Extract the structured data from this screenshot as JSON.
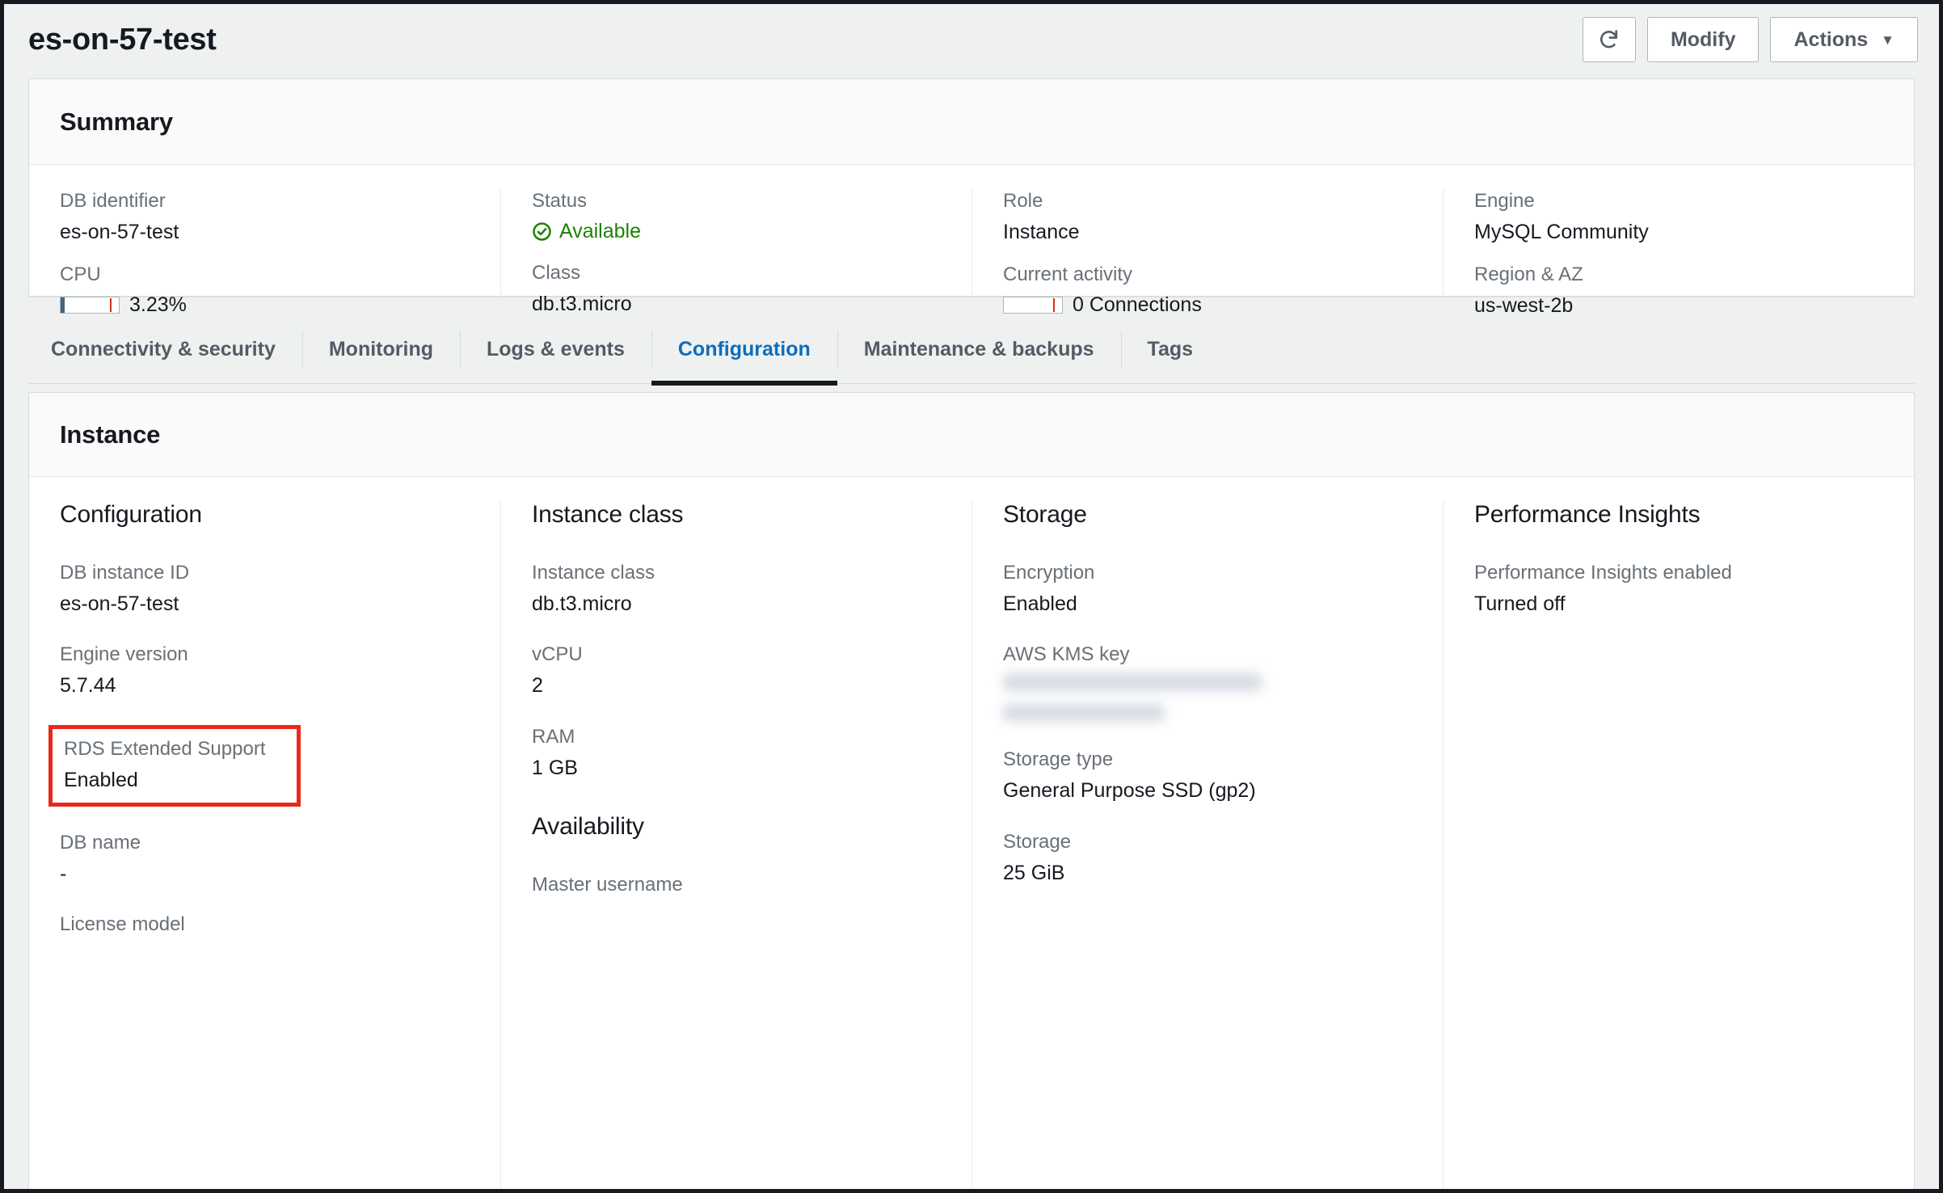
{
  "header": {
    "title": "es-on-57-test",
    "refresh_icon": "refresh-icon",
    "modify_label": "Modify",
    "actions_label": "Actions",
    "actions_caret": "▼"
  },
  "summary": {
    "section_title": "Summary",
    "columns": [
      {
        "fields": [
          {
            "label": "DB identifier",
            "value": "es-on-57-test",
            "kind": "text"
          },
          {
            "label": "CPU",
            "value": "3.23%",
            "kind": "meter",
            "fill_pct": 7,
            "threshold_pct": 85
          }
        ]
      },
      {
        "fields": [
          {
            "label": "Status",
            "value": "Available",
            "kind": "status",
            "status_color": "#1d8102",
            "icon": "check-circle-icon"
          },
          {
            "label": "Class",
            "value": "db.t3.micro",
            "kind": "text"
          }
        ]
      },
      {
        "fields": [
          {
            "label": "Role",
            "value": "Instance",
            "kind": "text"
          },
          {
            "label": "Current activity",
            "value": "0 Connections",
            "kind": "meter",
            "fill_pct": 0,
            "threshold_pct": 85
          }
        ]
      },
      {
        "fields": [
          {
            "label": "Engine",
            "value": "MySQL Community",
            "kind": "text"
          },
          {
            "label": "Region & AZ",
            "value": "us-west-2b",
            "kind": "text"
          }
        ]
      }
    ]
  },
  "tabs": [
    {
      "label": "Connectivity & security",
      "active": false
    },
    {
      "label": "Monitoring",
      "active": false
    },
    {
      "label": "Logs & events",
      "active": false
    },
    {
      "label": "Configuration",
      "active": true
    },
    {
      "label": "Maintenance & backups",
      "active": false
    },
    {
      "label": "Tags",
      "active": false
    }
  ],
  "instance": {
    "section_title": "Instance",
    "configuration": {
      "title": "Configuration",
      "db_instance_id_label": "DB instance ID",
      "db_instance_id_value": "es-on-57-test",
      "engine_version_label": "Engine version",
      "engine_version_value": "5.7.44",
      "extended_support_label": "RDS Extended Support",
      "extended_support_value": "Enabled",
      "db_name_label": "DB name",
      "db_name_value": "-",
      "license_model_label": "License model"
    },
    "instance_class": {
      "title": "Instance class",
      "instance_class_label": "Instance class",
      "instance_class_value": "db.t3.micro",
      "vcpu_label": "vCPU",
      "vcpu_value": "2",
      "ram_label": "RAM",
      "ram_value": "1 GB",
      "availability_title": "Availability",
      "master_username_label": "Master username"
    },
    "storage": {
      "title": "Storage",
      "encryption_label": "Encryption",
      "encryption_value": "Enabled",
      "kms_key_label": "AWS KMS key",
      "kms_key_value": "",
      "storage_type_label": "Storage type",
      "storage_type_value": "General Purpose SSD (gp2)",
      "storage_label": "Storage",
      "storage_value": "25 GiB"
    },
    "performance_insights": {
      "title": "Performance Insights",
      "enabled_label": "Performance Insights enabled",
      "enabled_value": "Turned off"
    }
  },
  "colors": {
    "highlight_red": "#e8291c",
    "active_tab_blue": "#0a6ebd",
    "status_green": "#1d8102",
    "meter_fill": "#44647e",
    "meter_threshold": "#d13212"
  }
}
